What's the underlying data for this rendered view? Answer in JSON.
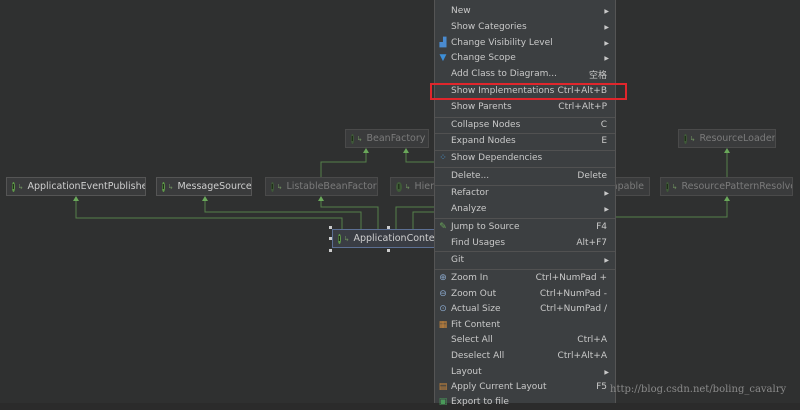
{
  "diagram": {
    "nodes": [
      {
        "label": "ApplicationEventPublisher"
      },
      {
        "label": "MessageSource"
      },
      {
        "label": "ListableBeanFactory"
      },
      {
        "label": "Hier"
      },
      {
        "label": "BeanFactory"
      },
      {
        "label": "ApplicationContex"
      },
      {
        "label": "ResourceLoader"
      },
      {
        "label": "ResourcePatternResolver"
      },
      {
        "label": "apable"
      }
    ],
    "node_icon": "I"
  },
  "menu": {
    "items": [
      {
        "label": "New",
        "submenu": true
      },
      {
        "label": "Show Categories",
        "submenu": true
      },
      {
        "label": "Change Visibility Level",
        "submenu": true,
        "icon": "visibility-icon"
      },
      {
        "label": "Change Scope",
        "submenu": true,
        "icon": "filter-icon"
      },
      {
        "label": "Add Class to Diagram...",
        "shortcut": "空格"
      },
      {
        "label": "Show Implementations",
        "shortcut": "Ctrl+Alt+B"
      },
      {
        "label": "Show Parents",
        "shortcut": "Ctrl+Alt+P"
      },
      {
        "label": "Collapse Nodes",
        "shortcut": "C"
      },
      {
        "label": "Expand Nodes",
        "shortcut": "E"
      },
      {
        "label": "Show Dependencies",
        "icon": "dependencies-icon"
      },
      {
        "label": "Delete...",
        "shortcut": "Delete"
      },
      {
        "label": "Refactor",
        "submenu": true
      },
      {
        "label": "Analyze",
        "submenu": true
      },
      {
        "label": "Jump to Source",
        "shortcut": "F4",
        "icon": "jump-icon"
      },
      {
        "label": "Find Usages",
        "shortcut": "Alt+F7"
      },
      {
        "label": "Git",
        "submenu": true
      },
      {
        "label": "Zoom In",
        "shortcut": "Ctrl+NumPad +",
        "icon": "zoom-in-icon"
      },
      {
        "label": "Zoom Out",
        "shortcut": "Ctrl+NumPad -",
        "icon": "zoom-out-icon"
      },
      {
        "label": "Actual Size",
        "shortcut": "Ctrl+NumPad /",
        "icon": "actual-size-icon"
      },
      {
        "label": "Fit Content",
        "icon": "fit-content-icon"
      },
      {
        "label": "Select All",
        "shortcut": "Ctrl+A"
      },
      {
        "label": "Deselect All",
        "shortcut": "Ctrl+Alt+A"
      },
      {
        "label": "Layout",
        "submenu": true
      },
      {
        "label": "Apply Current Layout",
        "shortcut": "F5",
        "icon": "layout-icon"
      },
      {
        "label": "Export to file",
        "icon": "export-icon"
      }
    ],
    "highlight_color": "#e0262c"
  },
  "watermark": "http://blog.csdn.net/boling_cavalry"
}
